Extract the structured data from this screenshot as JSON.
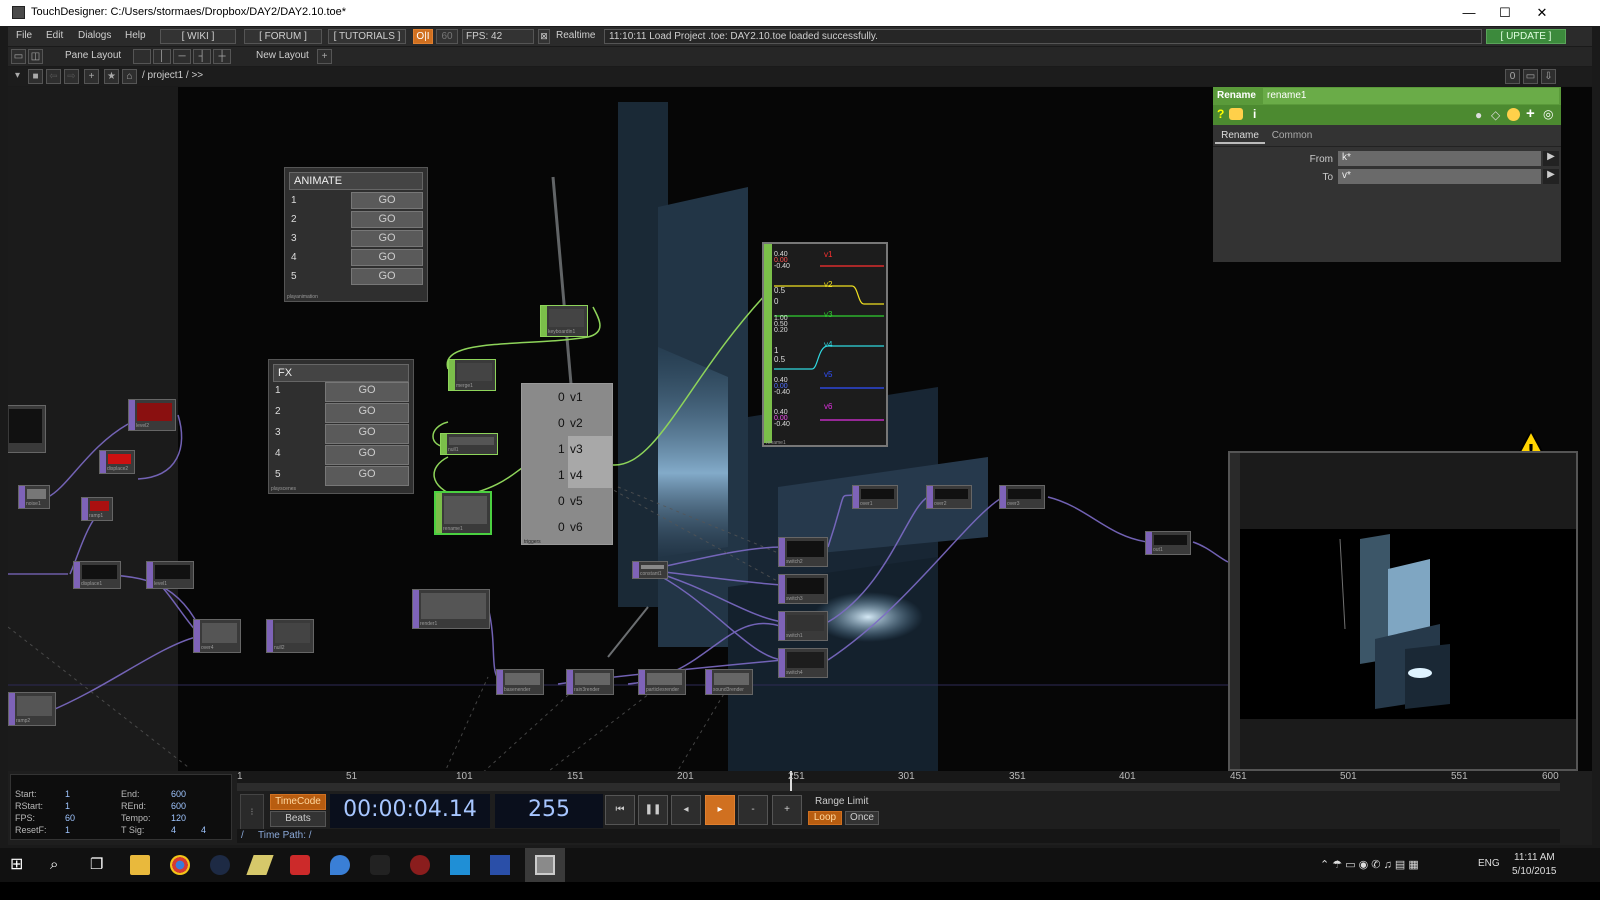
{
  "window": {
    "title": "TouchDesigner: C:/Users/stormaes/Dropbox/DAY2/DAY2.10.toe*",
    "minimize": "—",
    "maximize": "☐",
    "close": "✕"
  },
  "menu": {
    "items": [
      "File",
      "Edit",
      "Dialogs",
      "Help"
    ],
    "wiki": "[ WIKI ]",
    "forum": "[ FORUM ]",
    "tutorials": "[ TUTORIALS ]",
    "oi": "O|I",
    "fps_cap": "60",
    "fps": "FPS: 42",
    "realtime": "Realtime",
    "status": "11:10:11 Load Project .toe: DAY2.10.toe loaded successfully.",
    "update": "[ UPDATE ]"
  },
  "layout_bar": {
    "pane_layout": "Pane Layout",
    "new_layout": "New Layout",
    "plus": "+"
  },
  "path_bar": {
    "path": "/ project1 / >>",
    "zero": "0"
  },
  "panels": {
    "animate": {
      "title": "ANIMATE",
      "rows": [
        "1",
        "2",
        "3",
        "4",
        "5"
      ],
      "go": "GO",
      "footer": "playanimation"
    },
    "fx": {
      "title": "FX",
      "rows": [
        "1",
        "2",
        "3",
        "4",
        "5"
      ],
      "go": "GO",
      "footer": "playscenes"
    },
    "triggers": {
      "rows": [
        {
          "val": "0",
          "name": "v1"
        },
        {
          "val": "0",
          "name": "v2"
        },
        {
          "val": "1",
          "name": "v3"
        },
        {
          "val": "1",
          "name": "v4"
        },
        {
          "val": "0",
          "name": "v5"
        },
        {
          "val": "0",
          "name": "v6"
        }
      ],
      "footer": "triggers"
    },
    "chop_viewer": {
      "channels": [
        {
          "name": "v1",
          "color": "#ff3030",
          "ticks": [
            "0.40",
            "0.00",
            "-0.40"
          ]
        },
        {
          "name": "v2",
          "color": "#f0e020",
          "ticks": [
            "1",
            "0.5",
            "0"
          ]
        },
        {
          "name": "v3",
          "color": "#30d030",
          "ticks": [
            "1.00",
            "0.50",
            "0.20"
          ]
        },
        {
          "name": "v4",
          "color": "#30d8e0",
          "ticks": [
            "1",
            "0.5",
            "0"
          ]
        },
        {
          "name": "v5",
          "color": "#3050ff",
          "ticks": [
            "0.40",
            "0.00",
            "-0.40"
          ]
        },
        {
          "name": "v6",
          "color": "#e030e0",
          "ticks": [
            "0.40",
            "0.00",
            "-0.40"
          ]
        }
      ],
      "footer": "rename1"
    }
  },
  "nodes": [
    {
      "label": "keyboardin1"
    },
    {
      "label": "merge1"
    },
    {
      "label": "null1"
    },
    {
      "label": "rename1"
    },
    {
      "label": "constant1"
    },
    {
      "label": "render1"
    },
    {
      "label": "switch2"
    },
    {
      "label": "switch3"
    },
    {
      "label": "switch1"
    },
    {
      "label": "switch4"
    },
    {
      "label": "basenender"
    },
    {
      "label": "rain3render"
    },
    {
      "label": "particlesrender"
    },
    {
      "label": "sound3render"
    },
    {
      "label": "over1"
    },
    {
      "label": "over2"
    },
    {
      "label": "over3"
    },
    {
      "label": "out1"
    },
    {
      "label": "displace1"
    },
    {
      "label": "level1"
    },
    {
      "label": "noise1"
    },
    {
      "label": "ramp1"
    },
    {
      "label": "displace2"
    },
    {
      "label": "level2"
    },
    {
      "label": "over4"
    },
    {
      "label": "null2"
    },
    {
      "label": "ramp2"
    }
  ],
  "params": {
    "op_type": "Rename",
    "op_name": "rename1",
    "tabs": [
      "Rename",
      "Common"
    ],
    "fields": [
      {
        "label": "From",
        "value": "k*"
      },
      {
        "label": "To",
        "value": "v*"
      }
    ]
  },
  "timeline": {
    "ticks": [
      "1",
      "51",
      "101",
      "151",
      "201",
      "251",
      "301",
      "351",
      "401",
      "451",
      "501",
      "551",
      "600"
    ],
    "info": {
      "start_k": "Start:",
      "start_v": "1",
      "end_k": "End:",
      "end_v": "600",
      "rstart_k": "RStart:",
      "rstart_v": "1",
      "rend_k": "REnd:",
      "rend_v": "600",
      "fps_k": "FPS:",
      "fps_v": "60",
      "tempo_k": "Tempo:",
      "tempo_v": "120",
      "resetf_k": "ResetF:",
      "resetf_v": "1",
      "tsig_k": "T Sig:",
      "tsig_v1": "4",
      "tsig_v2": "4"
    },
    "timecode_btn": "TimeCode",
    "beats_btn": "Beats",
    "timecode": "00:00:04.14",
    "frame": "255",
    "range_limit": "Range Limit",
    "loop": "Loop",
    "once": "Once",
    "time_path": "Time Path: /",
    "slash": "/",
    "minus": "-",
    "plus": "+"
  },
  "taskbar": {
    "lang": "ENG",
    "time": "11:11 AM",
    "date": "5/10/2015"
  }
}
